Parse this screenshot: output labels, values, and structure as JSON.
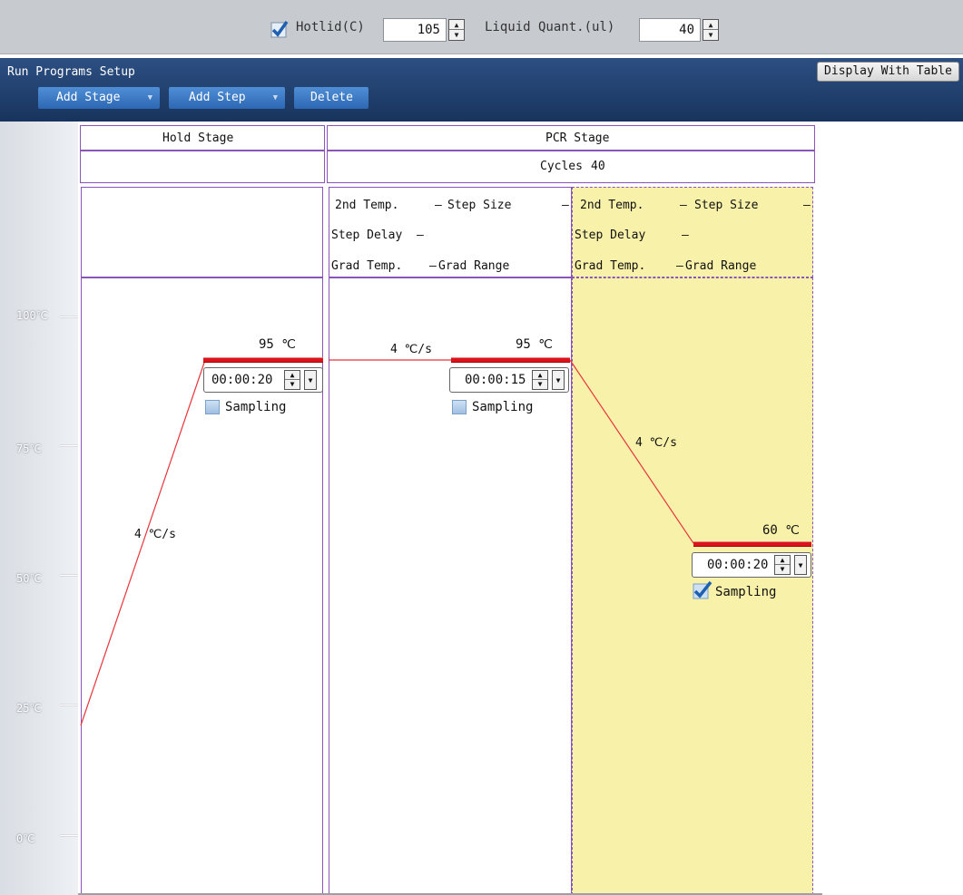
{
  "toolbar": {
    "hotlid_checked": true,
    "hotlid_label": "Hotlid(C)",
    "hotlid_value": "105",
    "liquid_label": "Liquid Quant.(ul)",
    "liquid_value": "40"
  },
  "header": {
    "title": "Run Programs Setup",
    "add_stage": "Add Stage",
    "add_step": "Add Step",
    "delete": "Delete",
    "display_with_table": "Display With Table"
  },
  "axis": {
    "labels": [
      "100℃",
      "75℃",
      "50℃",
      "25℃",
      "0℃"
    ]
  },
  "hold_stage": {
    "title": "Hold Stage",
    "step": {
      "temp": "95 ℃",
      "time": "00:00:20",
      "rate": "4 ℃/s",
      "sampling_label": "Sampling",
      "sampling": false
    }
  },
  "pcr_stage": {
    "title": "PCR Stage",
    "cycles_label": "Cycles",
    "cycles": "40",
    "info": {
      "second_temp": "2nd Temp.",
      "step_size": "Step Size",
      "step_delay": "Step Delay",
      "grad_temp": "Grad Temp.",
      "grad_range": "Grad Range",
      "dash": "–"
    },
    "step1": {
      "temp": "95 ℃",
      "time": "00:00:15",
      "rate": "4 ℃/s",
      "sampling_label": "Sampling",
      "sampling": false
    },
    "step2": {
      "temp": "60 ℃",
      "time": "00:00:20",
      "rate": "4 ℃/s",
      "sampling_label": "Sampling",
      "sampling": true
    }
  },
  "colors": {
    "selected_step_bg": "#f7f1a9",
    "stage_border": "#8a55b8",
    "temp_bar": "#d9141c",
    "ramp_line": "#e8353b",
    "header_blue": "#1f3e6c",
    "button_blue": "#3a78c4"
  }
}
